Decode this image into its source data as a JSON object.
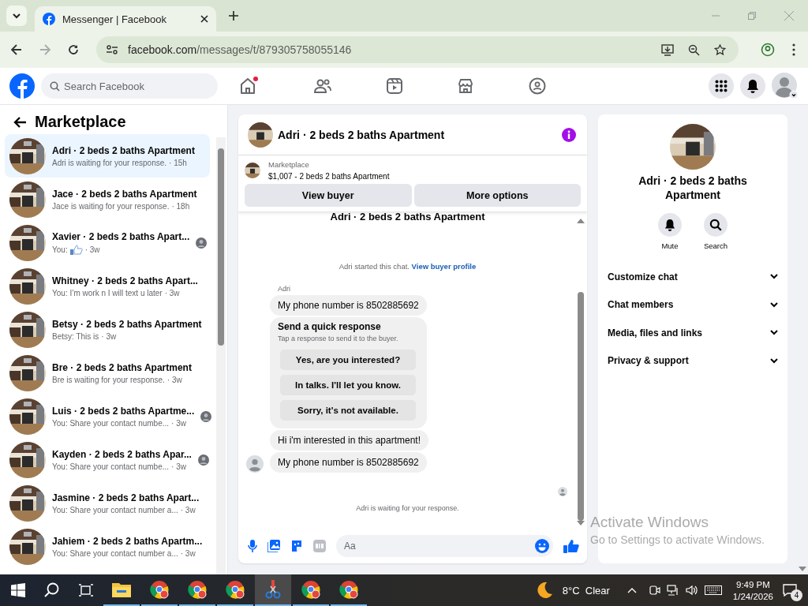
{
  "browser": {
    "tab_title": "Messenger | Facebook",
    "url_host": "facebook.com",
    "url_path": "/messages/t/879305758055146"
  },
  "facebook_nav": {
    "search_placeholder": "Search Facebook",
    "home_notification": true
  },
  "sidebar": {
    "title": "Marketplace",
    "conversations": [
      {
        "title": "Adri · 2 beds 2 baths Apartment",
        "preview": "Adri is waiting for your response.",
        "time": "· 15h",
        "selected": true,
        "seen": false,
        "like": false
      },
      {
        "title": "Jace · 2 beds 2 baths Apartment",
        "preview": "Jace is waiting for your response.",
        "time": "· 18h",
        "selected": false,
        "seen": false,
        "like": false
      },
      {
        "title": "Xavier · 2 beds 2 baths Apart...",
        "preview": "You:",
        "time": "· 3w",
        "selected": false,
        "seen": true,
        "like": true
      },
      {
        "title": "Whitney · 2 beds 2 baths Apart...",
        "preview": "You: I’m work n I will text u later",
        "time": "· 3w",
        "selected": false,
        "seen": false,
        "like": false
      },
      {
        "title": "Betsy · 2 beds 2 baths Apartment",
        "preview": "Betsy: This is",
        "time": "· 3w",
        "selected": false,
        "seen": false,
        "like": false
      },
      {
        "title": "Bre · 2 beds 2 baths Apartment",
        "preview": "Bre is waiting for your response.",
        "time": "· 3w",
        "selected": false,
        "seen": false,
        "like": false
      },
      {
        "title": "Luis · 2 beds 2 baths Apartme...",
        "preview": "You: Share your contact numbe...",
        "time": "· 3w",
        "selected": false,
        "seen": true,
        "like": false
      },
      {
        "title": "Kayden · 2 beds 2 baths Apar...",
        "preview": "You: Share your contact numbe...",
        "time": "· 3w",
        "selected": false,
        "seen": true,
        "like": false
      },
      {
        "title": "Jasmine · 2 beds 2 baths Apart...",
        "preview": "You: Share your contact number a...",
        "time": "· 3w",
        "selected": false,
        "seen": false,
        "like": false
      },
      {
        "title": "Jahiem · 2 beds 2 baths Apartm...",
        "preview": "You: Share your contact number a...",
        "time": "· 3w",
        "selected": false,
        "seen": false,
        "like": false
      }
    ]
  },
  "chat": {
    "title": "Adri · 2 beds 2 baths Apartment",
    "listing": {
      "label": "Marketplace",
      "summary": "$1,007 - 2 beds 2 baths Apartment"
    },
    "actions": [
      "View buyer",
      "More options"
    ],
    "cut_heading": "Adri · 2 beds 2 baths Apartment",
    "started": {
      "text": "Adri started this chat.",
      "link": "View buyer profile"
    },
    "messages": [
      {
        "kind": "sender",
        "text": "Adri"
      },
      {
        "kind": "bubble",
        "text": "My phone number is 8502885692",
        "avatar": false
      },
      {
        "kind": "quick",
        "title": "Send a quick response",
        "subtitle": "Tap a response to send it to the buyer.",
        "options": [
          "Yes, are you interested?",
          "In talks. I'll let you know.",
          "Sorry, it's not available."
        ]
      },
      {
        "kind": "bubble",
        "text": "Hi i'm interested in this apartment!",
        "avatar": false
      },
      {
        "kind": "bubble",
        "text": "My phone number is 8502885692",
        "avatar": true
      }
    ],
    "status": "Adri is waiting for your response.",
    "composer_placeholder": "Aa"
  },
  "details": {
    "title": "Adri · 2 beds 2 baths Apartment",
    "actions": [
      {
        "kind": "mute",
        "label": "Mute"
      },
      {
        "kind": "search",
        "label": "Search"
      }
    ],
    "sections": [
      "Customize chat",
      "Chat members",
      "Media, files and links",
      "Privacy & support"
    ]
  },
  "activation": {
    "title": "Activate Windows",
    "subtitle": "Go to Settings to activate Windows."
  },
  "taskbar": {
    "apps": [
      {
        "kind": "folder",
        "selected": false
      },
      {
        "kind": "browser",
        "selected": false
      },
      {
        "kind": "browser",
        "selected": false
      },
      {
        "kind": "browser",
        "selected": false
      },
      {
        "kind": "snip",
        "selected": true
      },
      {
        "kind": "browser",
        "selected": false
      },
      {
        "kind": "browser",
        "selected": false
      }
    ],
    "weather": "8°C  Clear",
    "time": "9:49 PM",
    "date": "1/24/2026",
    "notifications": "4"
  }
}
